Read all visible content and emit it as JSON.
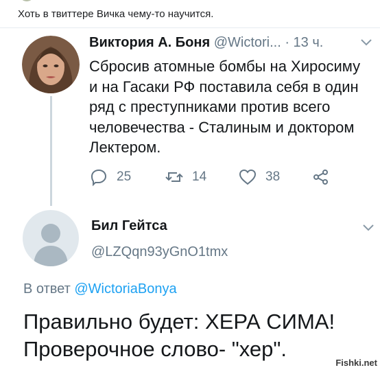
{
  "post": {
    "caption": "Хоть в твиттере Вичка чему-то научится."
  },
  "tweet": {
    "author_name": "Виктория А. Боня",
    "author_handle": "@Wictori...",
    "time": "· 13 ч.",
    "text": "Сбросив атомные бомбы на Хиросиму и на Гасаки РФ поставила себя в один ряд с преступниками против всего человечества - Сталиным и доктором Лектером.",
    "replies": "25",
    "retweets": "14",
    "likes": "38",
    "icons": [
      "reply-icon",
      "retweet-icon",
      "like-icon",
      "share-icon"
    ]
  },
  "reply": {
    "author_name": "Бил Гейтса",
    "author_handle": "@LZQqn93yGnO1tmx",
    "reply_prefix": "В ответ",
    "reply_mention": "@WictoriaBonya",
    "text": "Правильно будет: ХЕРА СИМА! Проверочное слово- \"хер\"."
  },
  "watermark": "Fishki.net",
  "colors": {
    "link": "#1da1f2",
    "secondary_text": "#657786",
    "thread_line": "#ccd6dd"
  }
}
